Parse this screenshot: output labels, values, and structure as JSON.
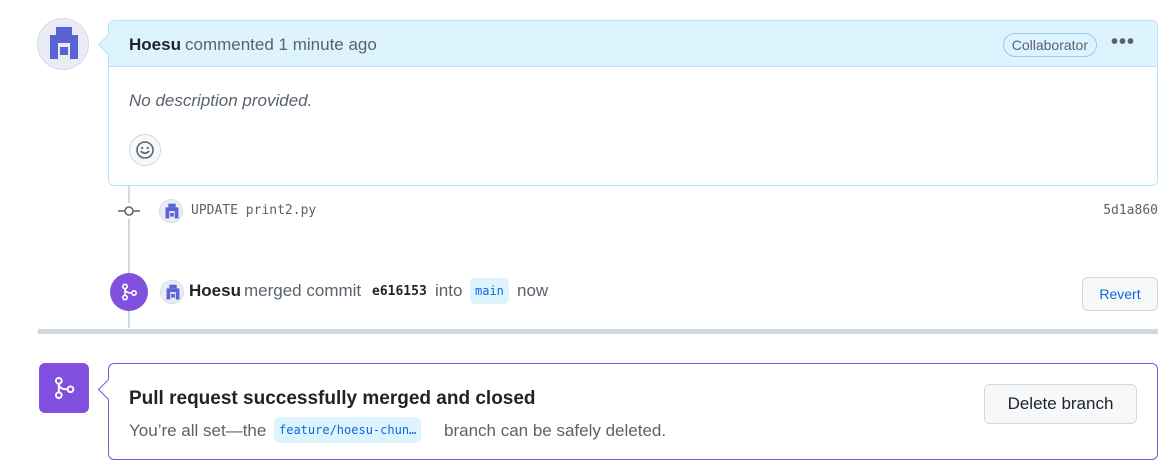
{
  "comment": {
    "author": "Hoesu",
    "action_text": "commented 1 minute ago",
    "role_badge": "Collaborator",
    "more_icon": "kebab-horizontal-icon",
    "description": "No description provided.",
    "reaction_icon": "smiley-icon"
  },
  "commit": {
    "message": "UPDATE print2.py",
    "sha": "5d1a860",
    "icon": "git-commit-icon"
  },
  "merge_event": {
    "author": "Hoesu",
    "text_before": "merged commit",
    "commit_sha": "e616153",
    "text_into": "into",
    "target_branch": "main",
    "time": "now",
    "revert_label": "Revert",
    "icon": "git-merge-icon"
  },
  "merge_status": {
    "title": "Pull request successfully merged and closed",
    "subtitle_before": "You’re all set—the",
    "branch": "feature/hoesu-chun…",
    "subtitle_after": "branch can be safely deleted.",
    "delete_branch_label": "Delete branch",
    "icon": "git-merge-icon"
  },
  "colors": {
    "merged_purple": "#8250df",
    "link_blue": "#0969da",
    "comment_header_bg": "#ddf4ff"
  }
}
